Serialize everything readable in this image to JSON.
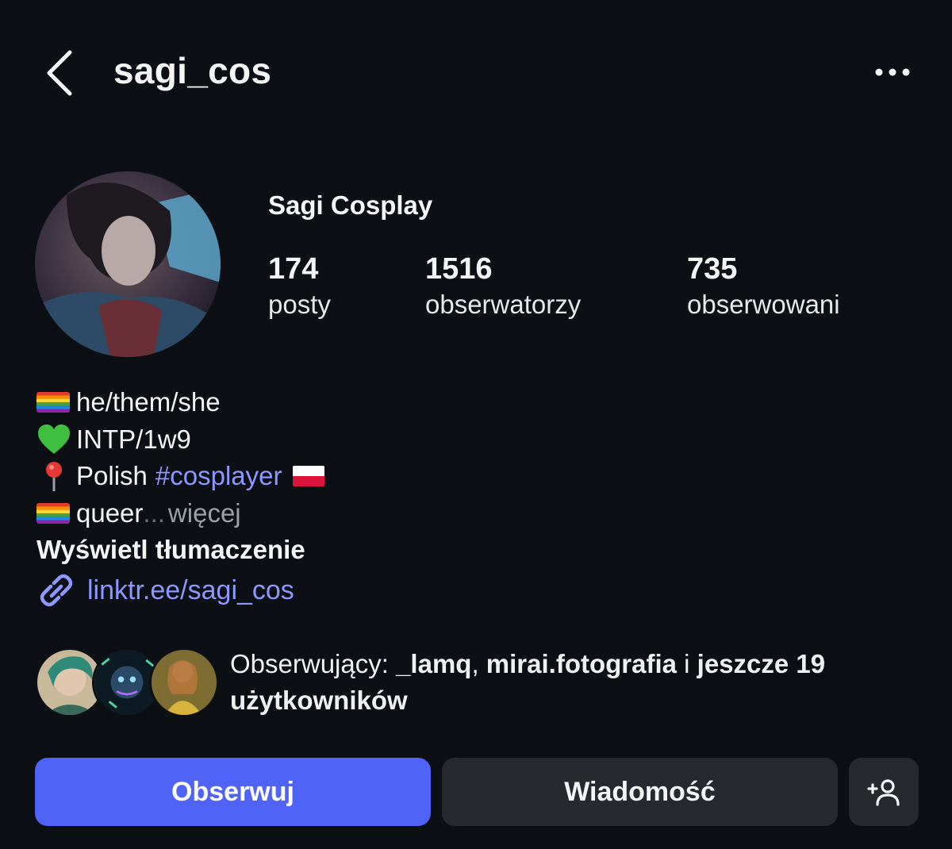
{
  "header": {
    "username": "sagi_cos",
    "back_icon": "chevron-left-icon",
    "more_icon": "more-horizontal-icon"
  },
  "profile": {
    "display_name": "Sagi Cosplay",
    "stats": {
      "posts_count": "174",
      "posts_label": "posty",
      "followers_count": "1516",
      "followers_label": "obserwatorzy",
      "following_count": "735",
      "following_label": "obserwowani"
    }
  },
  "bio": {
    "line1": "he/them/she",
    "line2": "INTP/1w9",
    "line3_text": "Polish",
    "line3_hashtag": "#cosplayer",
    "line4_text": "queer",
    "ellipsis": "...",
    "more_label": "więcej",
    "translate_label": "Wyświetl tłumaczenie",
    "link": "linktr.ee/sagi_cos",
    "icons": [
      "rainbow-flag-icon",
      "green-heart-icon",
      "pin-icon",
      "polish-flag-icon",
      "link-icon"
    ]
  },
  "mutuals": {
    "prefix": "Obserwujący: ",
    "user1": "_lamq",
    "separator": ", ",
    "user2": "mirai.fotografia",
    "conjunction": " i ",
    "rest": "jeszcze 19 użytkowników"
  },
  "actions": {
    "follow_label": "Obserwuj",
    "message_label": "Wiadomość",
    "add_user_icon": "add-user-icon"
  },
  "colors": {
    "background": "#0c1014",
    "accent": "#4f63f7",
    "link": "#8d98ff",
    "secondary_button": "#26292e"
  }
}
